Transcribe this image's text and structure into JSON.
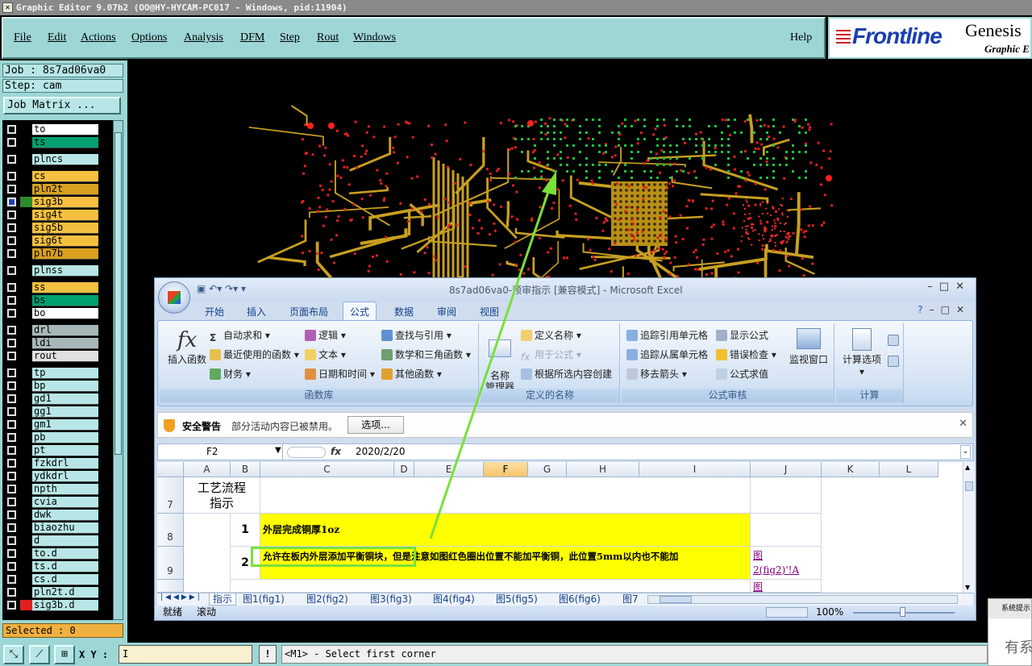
{
  "window_title": "Graphic Editor 9.07b2 (OO@HY-HYCAM-PC017 - Windows, pid:11904)",
  "menu": {
    "items": [
      "File",
      "Edit",
      "Actions",
      "Options",
      "Analysis",
      "DFM",
      "Step",
      "Rout",
      "Windows"
    ],
    "help": "Help"
  },
  "logo": {
    "brand": "Frontline",
    "product": "Genesis",
    "sub": "Graphic E"
  },
  "job_label": "Job : 8s7ad06va0",
  "step_label": "Step: cam",
  "job_matrix_button": "Job Matrix ...",
  "layers": [
    {
      "name": "to",
      "color": "#ffffff",
      "swatch": "#000000"
    },
    {
      "name": "ts",
      "color": "#00a070",
      "swatch": "#000000"
    },
    {
      "name": "plncs",
      "color": "#b8e6e6",
      "swatch": "#000000"
    },
    {
      "name": "cs",
      "color": "#f5c040",
      "swatch": "#000000"
    },
    {
      "name": "pln2t",
      "color": "#d9a020",
      "swatch": "#000000"
    },
    {
      "name": "sig3b",
      "color": "#f5c040",
      "swatch": "#2e8b2e",
      "active": true
    },
    {
      "name": "sig4t",
      "color": "#f5c040",
      "swatch": "#000000"
    },
    {
      "name": "sig5b",
      "color": "#f5c040",
      "swatch": "#000000"
    },
    {
      "name": "sig6t",
      "color": "#f5c040",
      "swatch": "#000000"
    },
    {
      "name": "pln7b",
      "color": "#d9a020",
      "swatch": "#000000"
    },
    {
      "name": "plnss",
      "color": "#b8e6e6",
      "swatch": "#000000"
    },
    {
      "name": "ss",
      "color": "#f5c040",
      "swatch": "#000000"
    },
    {
      "name": "bs",
      "color": "#00a070",
      "swatch": "#000000"
    },
    {
      "name": "bo",
      "color": "#ffffff",
      "swatch": "#000000"
    },
    {
      "name": "drl",
      "color": "#a8b8b8",
      "swatch": "#000000"
    },
    {
      "name": "ldi",
      "color": "#a8b8b8",
      "swatch": "#000000"
    },
    {
      "name": "rout",
      "color": "#e0e0e0",
      "swatch": "#000000"
    },
    {
      "name": "tp",
      "color": "#b8e6e6",
      "swatch": "#000000"
    },
    {
      "name": "bp",
      "color": "#b8e6e6",
      "swatch": "#000000"
    },
    {
      "name": "gd1",
      "color": "#b8e6e6",
      "swatch": "#000000"
    },
    {
      "name": "gg1",
      "color": "#b8e6e6",
      "swatch": "#000000"
    },
    {
      "name": "gm1",
      "color": "#b8e6e6",
      "swatch": "#000000"
    },
    {
      "name": "pb",
      "color": "#b8e6e6",
      "swatch": "#000000"
    },
    {
      "name": "pt",
      "color": "#b8e6e6",
      "swatch": "#000000"
    },
    {
      "name": "fzkdrl",
      "color": "#b8e6e6",
      "swatch": "#000000"
    },
    {
      "name": "ydkdrl",
      "color": "#b8e6e6",
      "swatch": "#000000"
    },
    {
      "name": "npth",
      "color": "#b8e6e6",
      "swatch": "#000000"
    },
    {
      "name": "cvia",
      "color": "#b8e6e6",
      "swatch": "#000000"
    },
    {
      "name": "dwk",
      "color": "#b8e6e6",
      "swatch": "#000000"
    },
    {
      "name": "biaozhu",
      "color": "#b8e6e6",
      "swatch": "#000000"
    },
    {
      "name": "d",
      "color": "#b8e6e6",
      "swatch": "#000000"
    },
    {
      "name": "to.d",
      "color": "#b8e6e6",
      "swatch": "#000000"
    },
    {
      "name": "ts.d",
      "color": "#b8e6e6",
      "swatch": "#000000"
    },
    {
      "name": "cs.d",
      "color": "#b8e6e6",
      "swatch": "#000000"
    },
    {
      "name": "pln2t.d",
      "color": "#b8e6e6",
      "swatch": "#000000"
    },
    {
      "name": "sig3b.d",
      "color": "#b8e6e6",
      "swatch": "#e02020"
    }
  ],
  "selected_label": "Selected : 0",
  "xy_label": "X Y :",
  "xy_value": "I",
  "status_text": "<M1> - Select first corner",
  "excel": {
    "title": "8s7ad06va0-预审指示 [兼容模式] - Microsoft Excel",
    "tabs": [
      "开始",
      "插入",
      "页面布局",
      "公式",
      "数据",
      "审阅",
      "视图"
    ],
    "active_tab": "公式",
    "groups": {
      "func_lib": {
        "label": "函数库",
        "insert_fn": "插入函数",
        "buttons": [
          "自动求和",
          "最近使用的函数",
          "财务",
          "逻辑",
          "文本",
          "日期和时间",
          "查找与引用",
          "数学和三角函数",
          "其他函数"
        ]
      },
      "names": {
        "label": "定义的名称",
        "name_mgr": "名称\n管理器",
        "buttons": [
          "定义名称",
          "用于公式",
          "根据所选内容创建"
        ]
      },
      "audit": {
        "label": "公式审核",
        "buttons": [
          "追踪引用单元格",
          "追踪从属单元格",
          "移去箭头",
          "显示公式",
          "错误检查",
          "公式求值"
        ],
        "watch": "监视窗口"
      },
      "calc": {
        "label": "计算",
        "options": "计算选项"
      }
    },
    "security": {
      "title": "安全警告",
      "message": "部分活动内容已被禁用。",
      "button": "选项..."
    },
    "name_box": "F2",
    "formula_value": "2020/2/20",
    "columns": [
      "A",
      "B",
      "C",
      "D",
      "E",
      "F",
      "G",
      "H",
      "I",
      "J",
      "K",
      "L"
    ],
    "rows": {
      "r7": {
        "num": "7",
        "a": "工艺流程\n指示"
      },
      "r8": {
        "num": "8",
        "b": "1",
        "c": "外层完成铜厚1oz"
      },
      "r9": {
        "num": "9",
        "b": "2",
        "c": "允许在板内外层添加平衡铜块，但是注意如图红色圈出位置不能加平衡铜，此位置5mm以内也不能加",
        "j": "图\n2(fig2)'!A"
      },
      "r10": {
        "num": "",
        "j": "图"
      }
    },
    "sheets": [
      "指示",
      "图1(fig1)",
      "图2(fig2)",
      "图3(fig3)",
      "图4(fig4)",
      "图5(fig5)",
      "图6(fig6)",
      "图7"
    ],
    "status_ready": "就绪",
    "status_scroll": "滚动",
    "zoom": "100%"
  },
  "side_window": {
    "header": "系统提示",
    "body": "有系"
  }
}
